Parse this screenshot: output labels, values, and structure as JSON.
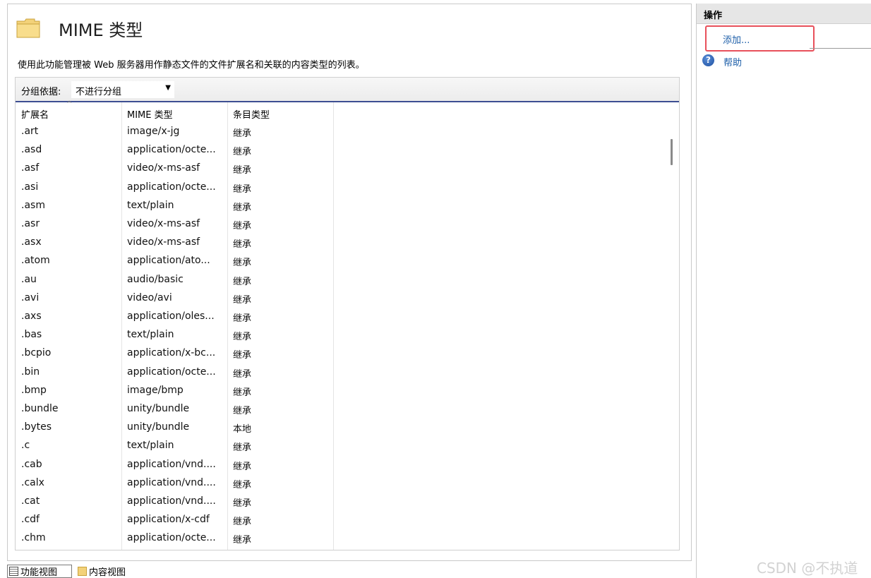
{
  "header": {
    "title": "MIME 类型",
    "description": "使用此功能管理被 Web 服务器用作静态文件的文件扩展名和关联的内容类型的列表。"
  },
  "groupbar": {
    "label": "分组依据:",
    "value": "不进行分组"
  },
  "table": {
    "columns": [
      "扩展名",
      "MIME 类型",
      "条目类型"
    ],
    "rows": [
      [
        ".art",
        "image/x-jg",
        "继承"
      ],
      [
        ".asd",
        "application/octe...",
        "继承"
      ],
      [
        ".asf",
        "video/x-ms-asf",
        "继承"
      ],
      [
        ".asi",
        "application/octe...",
        "继承"
      ],
      [
        ".asm",
        "text/plain",
        "继承"
      ],
      [
        ".asr",
        "video/x-ms-asf",
        "继承"
      ],
      [
        ".asx",
        "video/x-ms-asf",
        "继承"
      ],
      [
        ".atom",
        "application/ato...",
        "继承"
      ],
      [
        ".au",
        "audio/basic",
        "继承"
      ],
      [
        ".avi",
        "video/avi",
        "继承"
      ],
      [
        ".axs",
        "application/oles...",
        "继承"
      ],
      [
        ".bas",
        "text/plain",
        "继承"
      ],
      [
        ".bcpio",
        "application/x-bc...",
        "继承"
      ],
      [
        ".bin",
        "application/octe...",
        "继承"
      ],
      [
        ".bmp",
        "image/bmp",
        "继承"
      ],
      [
        ".bundle",
        "unity/bundle",
        "继承"
      ],
      [
        ".bytes",
        "unity/bundle",
        "本地"
      ],
      [
        ".c",
        "text/plain",
        "继承"
      ],
      [
        ".cab",
        "application/vnd....",
        "继承"
      ],
      [
        ".calx",
        "application/vnd....",
        "继承"
      ],
      [
        ".cat",
        "application/vnd....",
        "继承"
      ],
      [
        ".cdf",
        "application/x-cdf",
        "继承"
      ],
      [
        ".chm",
        "application/octe...",
        "继承"
      ]
    ]
  },
  "bottom_tabs": {
    "features_view": "功能视图",
    "content_view": "内容视图"
  },
  "actions": {
    "title": "操作",
    "add": "添加...",
    "help": "帮助"
  },
  "watermark": "CSDN @不执道",
  "colors": {
    "link": "#1c5ea8",
    "highlight": "#e8505b",
    "groupbar_border": "#3d4e92"
  }
}
